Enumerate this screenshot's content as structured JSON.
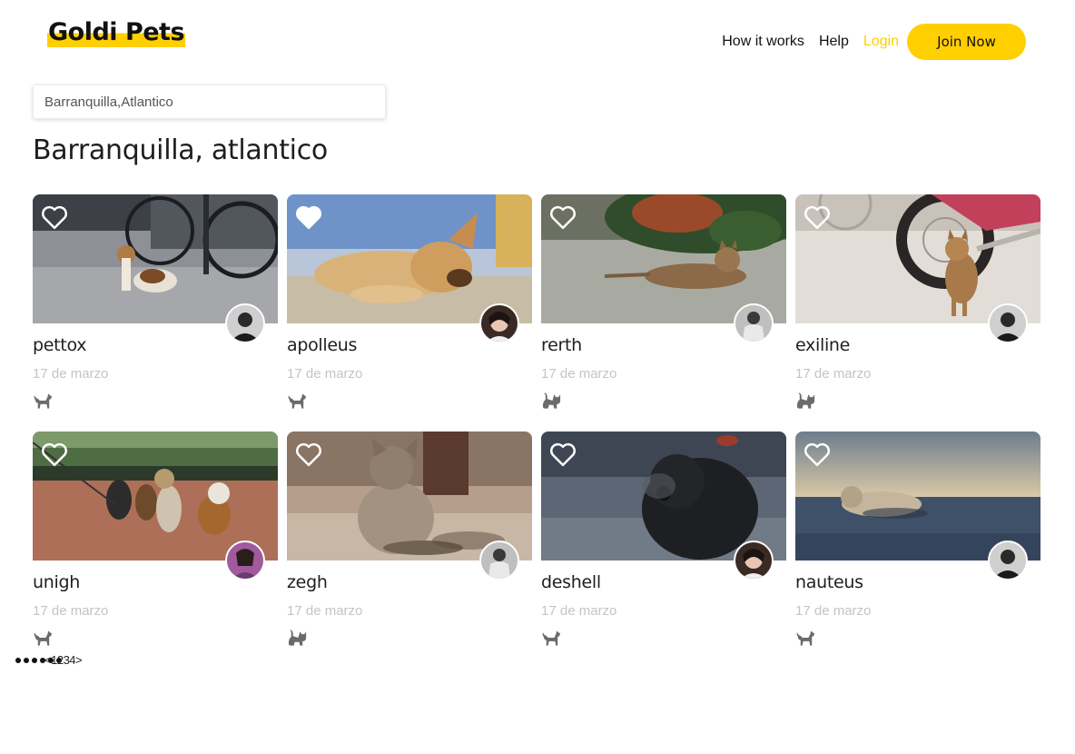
{
  "header": {
    "logo": "Goldi Pets",
    "nav": {
      "how_it_works": "How it works",
      "help": "Help",
      "login": "Login",
      "join_now": "Join Now"
    }
  },
  "search": {
    "value": "Barranquilla,Atlantico"
  },
  "page_title": "Barranquilla, atlantico",
  "colors": {
    "accent": "#ffcf00",
    "date_text": "#c4c4c4",
    "icon_gray": "#6b6b6b"
  },
  "cards": [
    {
      "name": "pettox",
      "date": "17 de marzo",
      "pet_icon": "dog-icon",
      "favorited": false
    },
    {
      "name": "apolleus",
      "date": "17 de marzo",
      "pet_icon": "dog-icon",
      "favorited": true
    },
    {
      "name": "rerth",
      "date": "17 de marzo",
      "pet_icon": "cat-icon",
      "favorited": false
    },
    {
      "name": "exiline",
      "date": "17 de marzo",
      "pet_icon": "cat-icon",
      "favorited": false
    },
    {
      "name": "unigh",
      "date": "17 de marzo",
      "pet_icon": "dog-icon",
      "favorited": false
    },
    {
      "name": "zegh",
      "date": "17 de marzo",
      "pet_icon": "cat-icon",
      "favorited": false
    },
    {
      "name": "deshell",
      "date": "17 de marzo",
      "pet_icon": "dog-icon",
      "favorited": false
    },
    {
      "name": "nauteus",
      "date": "17 de marzo",
      "pet_icon": "dog-icon",
      "favorited": false
    }
  ],
  "pagination": {
    "prev": "<",
    "pages": [
      "1",
      "2",
      "3",
      "4"
    ],
    "next": ">"
  }
}
